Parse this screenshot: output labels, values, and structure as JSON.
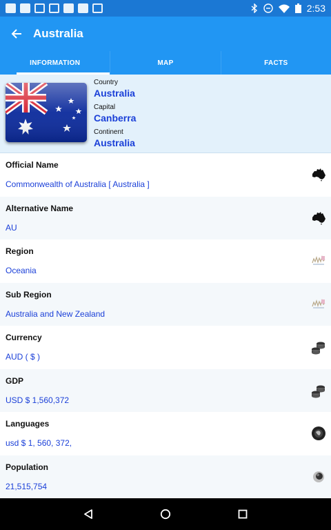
{
  "status_bar": {
    "time": "2:53"
  },
  "app_bar": {
    "title": "Australia"
  },
  "tabs": [
    {
      "label": "INFORMATION",
      "active": true
    },
    {
      "label": "MAP",
      "active": false
    },
    {
      "label": "FACTS",
      "active": false
    }
  ],
  "header": {
    "country_label": "Country",
    "country": "Australia",
    "capital_label": "Capital",
    "capital": "Canberra",
    "continent_label": "Continent",
    "continent": "Australia"
  },
  "rows": [
    {
      "label": "Official Name",
      "value": "Commonwealth of Australia [ Australia ]",
      "icon": "australia-map-icon"
    },
    {
      "label": "Alternative Name",
      "value": "AU",
      "icon": "australia-map-icon"
    },
    {
      "label": "Region",
      "value": "Oceania",
      "icon": "region-map-icon"
    },
    {
      "label": "Sub Region",
      "value": "Australia and New Zealand",
      "icon": "region-map-icon"
    },
    {
      "label": "Currency",
      "value": "AUD ( $ )",
      "icon": "coins-icon"
    },
    {
      "label": "GDP",
      "value": "USD $ 1,560,372",
      "icon": "coins-icon"
    },
    {
      "label": "Languages",
      "value": "usd $ 1, 560, 372,",
      "icon": "globe-icon"
    },
    {
      "label": "Population",
      "value": "21,515,754",
      "icon": "population-icon"
    }
  ],
  "colors": {
    "status_bar": "#1b78d4",
    "app_bar": "#2196f3",
    "header_bg": "#e3f1fb",
    "value_text": "#1a3fd8"
  }
}
